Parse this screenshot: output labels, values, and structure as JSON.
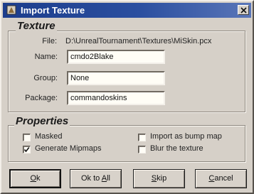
{
  "window": {
    "title": "Import Texture",
    "close_glyph": "×"
  },
  "texture": {
    "section_title": "Texture",
    "file_label": "File:",
    "file_value": "D:\\UnrealTournament\\Textures\\MiSkin.pcx",
    "name_label": "Name:",
    "name_value": "cmdo2Blake",
    "group_label": "Group:",
    "group_value": "None",
    "package_label": "Package:",
    "package_value": "commandoskins"
  },
  "properties": {
    "section_title": "Properties",
    "options": [
      {
        "label": "Masked",
        "checked": false
      },
      {
        "label": "Generate Mipmaps",
        "checked": true
      },
      {
        "label": "Import as bump map",
        "checked": false
      },
      {
        "label": "Blur the texture",
        "checked": false
      }
    ]
  },
  "buttons": {
    "ok": {
      "mnemonic": "O",
      "rest": "k"
    },
    "ok_to_all": {
      "prefix": "Ok to ",
      "mnemonic": "A",
      "rest": "ll"
    },
    "skip": {
      "mnemonic": "S",
      "rest": "kip"
    },
    "cancel": {
      "mnemonic": "C",
      "rest": "ancel"
    }
  },
  "colors": {
    "titlebar": "#1c3d8c",
    "dialog_face": "#d6d0c8",
    "field_bg": "#fffdf6"
  },
  "icons": {
    "app_icon": "app-icon",
    "close_icon": "close-icon",
    "check_icon": "check-icon"
  }
}
